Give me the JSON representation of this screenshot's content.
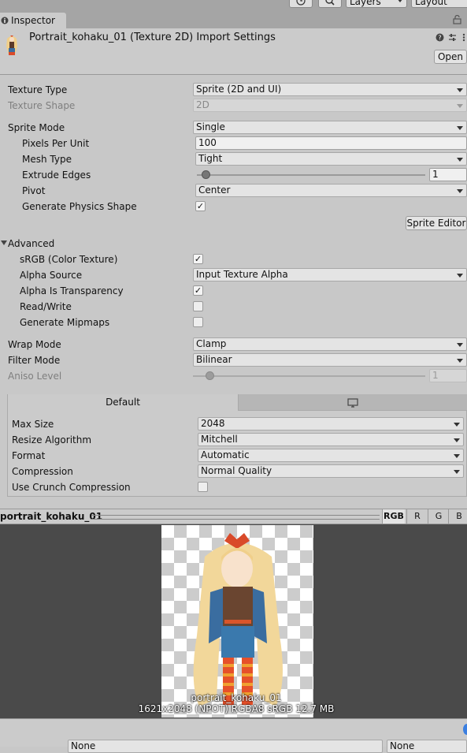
{
  "toolbar": {
    "history_icon": "history-icon",
    "search_icon": "search-icon",
    "layers_label": "Layers",
    "layout_label": "Layout"
  },
  "tab": {
    "icon": "info-icon",
    "label": "Inspector",
    "lock_icon": "lock-icon"
  },
  "header": {
    "title": "Portrait_kohaku_01 (Texture 2D) Import Settings",
    "open_label": "Open",
    "help_icon": "help-icon",
    "presets_icon": "presets-icon",
    "menu_icon": "kebab-menu-icon"
  },
  "settings": {
    "texture_type": {
      "label": "Texture Type",
      "value": "Sprite (2D and UI)"
    },
    "texture_shape": {
      "label": "Texture Shape",
      "value": "2D"
    },
    "sprite_mode": {
      "label": "Sprite Mode",
      "value": "Single"
    },
    "pixels_per_unit": {
      "label": "Pixels Per Unit",
      "value": "100"
    },
    "mesh_type": {
      "label": "Mesh Type",
      "value": "Tight"
    },
    "extrude_edges": {
      "label": "Extrude Edges",
      "value": "1"
    },
    "pivot": {
      "label": "Pivot",
      "value": "Center"
    },
    "generate_physics_shape": {
      "label": "Generate Physics Shape",
      "checked": true
    },
    "sprite_editor_label": "Sprite Editor"
  },
  "advanced": {
    "label": "Advanced",
    "srgb": {
      "label": "sRGB (Color Texture)",
      "checked": true
    },
    "alpha_source": {
      "label": "Alpha Source",
      "value": "Input Texture Alpha"
    },
    "alpha_is_transparency": {
      "label": "Alpha Is Transparency",
      "checked": true
    },
    "read_write": {
      "label": "Read/Write",
      "checked": false
    },
    "generate_mipmaps": {
      "label": "Generate Mipmaps",
      "checked": false
    }
  },
  "wrap": {
    "wrap_mode": {
      "label": "Wrap Mode",
      "value": "Clamp"
    },
    "filter_mode": {
      "label": "Filter Mode",
      "value": "Bilinear"
    },
    "aniso_level": {
      "label": "Aniso Level",
      "value": "1"
    }
  },
  "platform": {
    "default_tab": "Default",
    "standalone_icon": "monitor-icon",
    "max_size": {
      "label": "Max Size",
      "value": "2048"
    },
    "resize_algorithm": {
      "label": "Resize Algorithm",
      "value": "Mitchell"
    },
    "format": {
      "label": "Format",
      "value": "Automatic"
    },
    "compression": {
      "label": "Compression",
      "value": "Normal Quality"
    },
    "use_crunch": {
      "label": "Use Crunch Compression",
      "checked": false
    }
  },
  "preview": {
    "title": "portrait_kohaku_01",
    "channels": [
      "RGB",
      "R",
      "G",
      "B"
    ],
    "name": "portrait_kohaku_01",
    "info": "1621x2048 (NPOT)  RGBA8 sRGB  12.7 MB"
  },
  "bottom": {
    "left_value": "None",
    "right_value": "None"
  }
}
